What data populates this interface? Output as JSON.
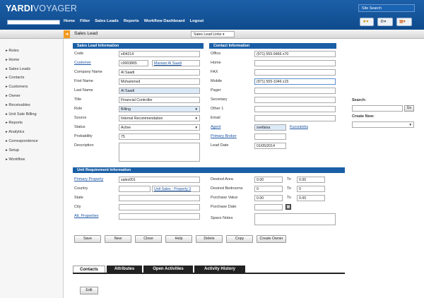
{
  "app": {
    "logo_brand": "YARDI",
    "logo_product": "VOYAGER",
    "site_search": "Site Search"
  },
  "nav": [
    "Home",
    "Filter",
    "Sales Leads",
    "Reports",
    "Workflow Dashboard",
    "Logout"
  ],
  "page": {
    "title": "Sales Lead",
    "links_dropdown": "Sales Lead Links"
  },
  "sidebar": [
    "Roles",
    "Home",
    "Sales Leads",
    "Contacts",
    "Customers",
    "Owner",
    "Receivables",
    "Unit Sale Billing",
    "Reports",
    "Analytics",
    "Correspondence",
    "Setup",
    "Workflow"
  ],
  "sales_lead": {
    "header": "Sales Lead Information",
    "labels": {
      "code": "Code",
      "customer": "Customer",
      "company": "Company Name",
      "first": "First Name",
      "last": "Last Name",
      "title": "Title",
      "role": "Role",
      "source": "Source",
      "status": "Status",
      "probability": "Probability",
      "description": "Description"
    },
    "values": {
      "code": "sl04214",
      "customer_code": "c0003865",
      "customer_name": "Marwan Al Saadi",
      "company": "Al Saadi",
      "first": "Mohammed",
      "last": "Al Saadi",
      "title": "Financial Controller",
      "role": "Billing",
      "source": "Internal Recommendation",
      "status": "Active",
      "probability": "75",
      "description": ""
    }
  },
  "contact": {
    "header": "Contact Information",
    "labels": {
      "office": "Office",
      "home": "Home",
      "fax": "FAX",
      "mobile": "Mobile",
      "pager": "Pager",
      "secretary": "Secretary",
      "other": "Other 1",
      "email": "Email",
      "agent": "Agent",
      "primary_broker": "Primary Broker",
      "lead_date": "Lead Date"
    },
    "values": {
      "office": "(971) 555-9466 x70",
      "home": "",
      "fax": "",
      "mobile": "(971) 555-1046 x15",
      "pager": "",
      "secretary": "",
      "other": "",
      "email": "",
      "agent_code": "svetlana",
      "agent_name": "Kuzuratska",
      "primary_broker": "",
      "lead_date": "01/05/2014"
    }
  },
  "unit": {
    "header": "Unit Requirement Information",
    "labels": {
      "primary_property": "Primary Property",
      "country": "Country",
      "state": "State",
      "city": "City",
      "alt_properties": "Alt. Properties",
      "desired_area": "Desired Area",
      "desired_bedrooms": "Desired Bedrooms",
      "purchase_value": "Purchase Value",
      "purchase_date": "Purchase Date",
      "space_notes": "Space Notes",
      "to": "To"
    },
    "values": {
      "primary_property": "sales001",
      "unit_sales_link": "Unit Sales - Property 3",
      "area_from": "0.00",
      "area_to": "0.00",
      "bedrooms_from": "0",
      "bedrooms_to": "0",
      "value_from": "0.00",
      "value_to": "0.00"
    }
  },
  "right_panel": {
    "search_label": "Search:",
    "go": "Go",
    "create_new": "Create New:"
  },
  "buttons": [
    "Save",
    "New",
    "Close",
    "Help",
    "Delete",
    "Copy",
    "Create Owner"
  ],
  "tabs": [
    "Contacts",
    "Attributes",
    "Open Activities",
    "Activity History"
  ],
  "edit_button": "Edit",
  "colors": {
    "header_blue": "#1a5fa6",
    "top_bar": "#1c5fa8",
    "accent_orange": "#f29a1f"
  }
}
